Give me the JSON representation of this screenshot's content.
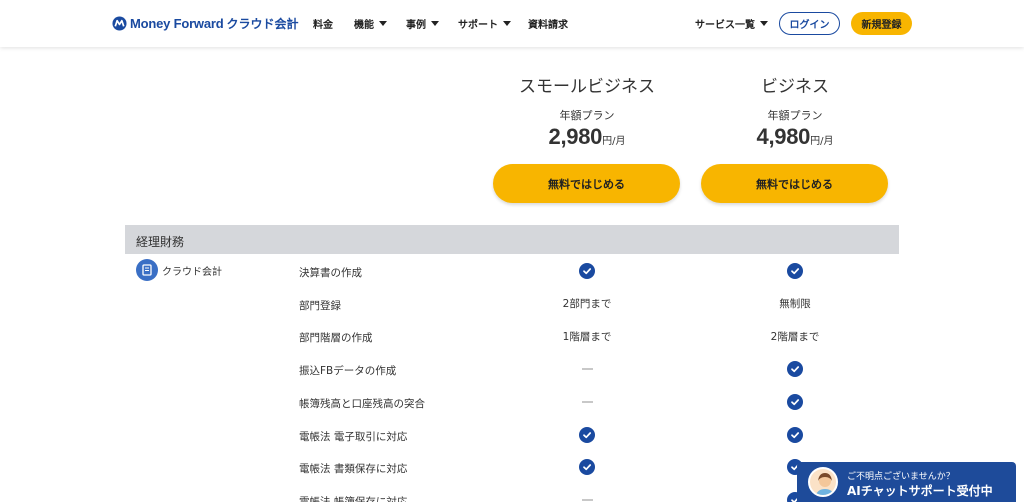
{
  "brand": {
    "logo_text": "Money Forward",
    "product_name": "クラウド会計",
    "color": "#1a4aa0"
  },
  "nav": [
    {
      "label": "料金",
      "has_dropdown": false
    },
    {
      "label": "機能",
      "has_dropdown": true
    },
    {
      "label": "事例",
      "has_dropdown": true
    },
    {
      "label": "サポート",
      "has_dropdown": true
    },
    {
      "label": "資料請求",
      "has_dropdown": false
    }
  ],
  "header_right": {
    "services_label": "サービス一覧",
    "login_label": "ログイン",
    "signup_label": "新規登録"
  },
  "plans": [
    {
      "name": "スモールビジネス",
      "billing": "年額プラン",
      "price": "2,980",
      "unit": "円/月",
      "cta": "無料ではじめる"
    },
    {
      "name": "ビジネス",
      "billing": "年額プラン",
      "price": "4,980",
      "unit": "円/月",
      "cta": "無料ではじめる"
    }
  ],
  "section": {
    "title": "経理財務",
    "product_label": "クラウド会計",
    "rows": [
      {
        "feature": "決算書の作成",
        "small": {
          "type": "check"
        },
        "business": {
          "type": "check"
        }
      },
      {
        "feature": "部門登録",
        "small": {
          "type": "text",
          "text": "2部門まで"
        },
        "business": {
          "type": "text",
          "text": "無制限"
        }
      },
      {
        "feature": "部門階層の作成",
        "small": {
          "type": "text",
          "text": "1階層まで"
        },
        "business": {
          "type": "text",
          "text": "2階層まで"
        }
      },
      {
        "feature": "振込FBデータの作成",
        "small": {
          "type": "dash"
        },
        "business": {
          "type": "check"
        }
      },
      {
        "feature": "帳簿残高と口座残高の突合",
        "small": {
          "type": "dash"
        },
        "business": {
          "type": "check"
        }
      },
      {
        "feature": "電帳法 電子取引に対応",
        "small": {
          "type": "check"
        },
        "business": {
          "type": "check"
        }
      },
      {
        "feature": "電帳法 書類保存に対応",
        "small": {
          "type": "check"
        },
        "business": {
          "type": "check"
        }
      },
      {
        "feature": "電帳法 帳簿保存に対応",
        "small": {
          "type": "dash"
        },
        "business": {
          "type": "check"
        }
      }
    ]
  },
  "chat": {
    "subtitle": "ご不明点ございませんか？",
    "title": "AIチャットサポート受付中"
  },
  "colors": {
    "accent_yellow": "#f8b500",
    "check_blue": "#1a4aa0",
    "section_bg": "#d5d7db",
    "chat_bg": "#1e4b9a"
  }
}
